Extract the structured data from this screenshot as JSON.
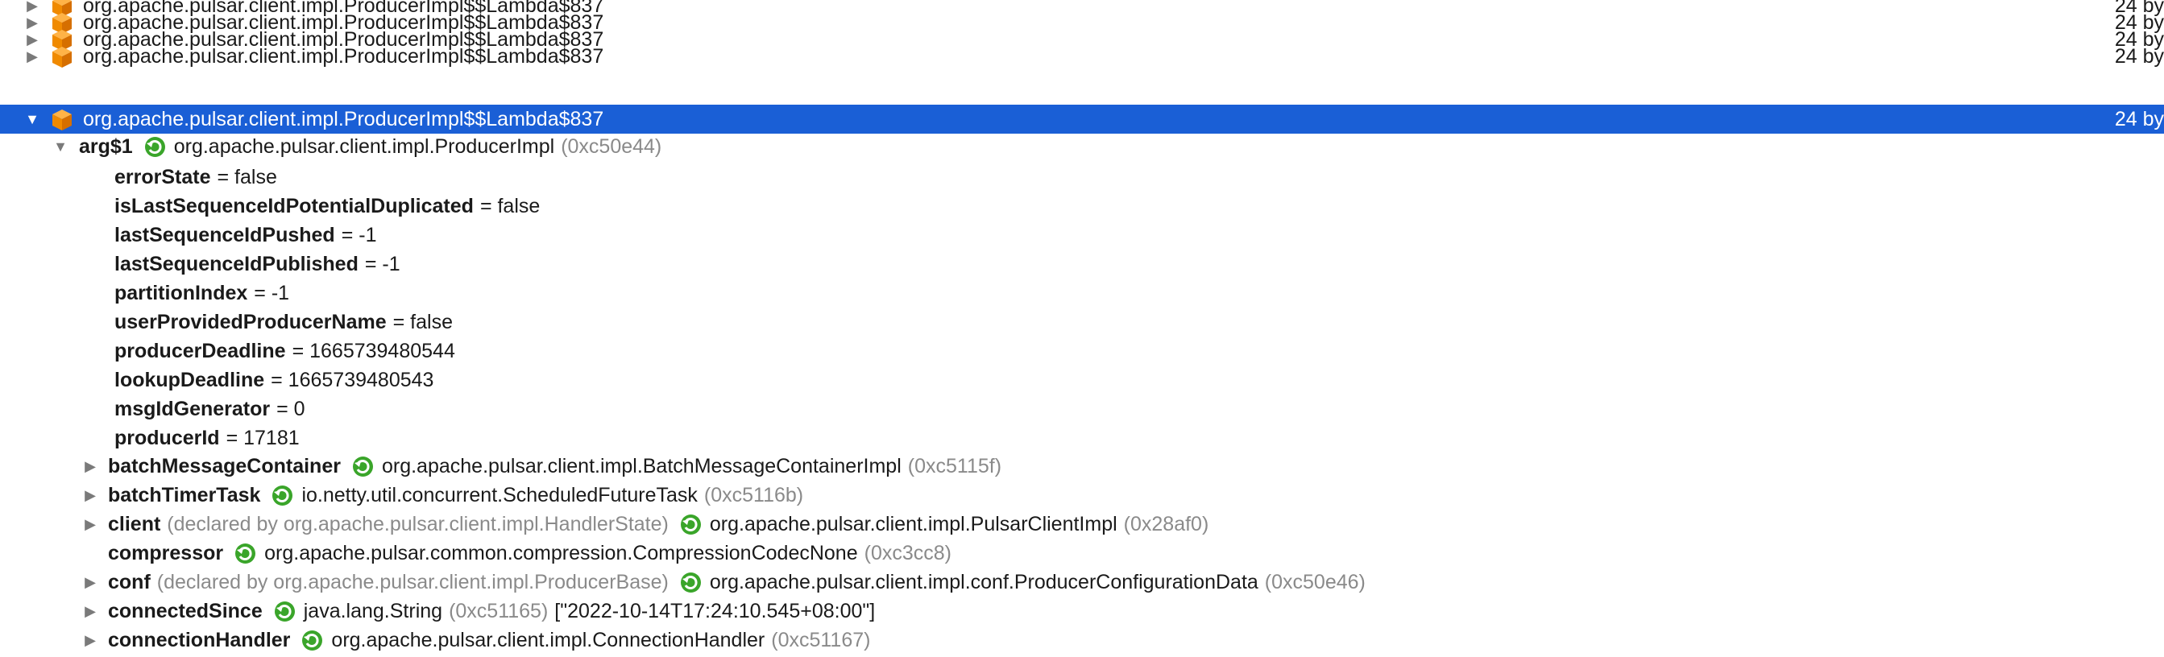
{
  "top_rows": [
    {
      "label": "org.apache.pulsar.client.impl.ProducerImpl$$Lambda$837",
      "size": "24 by"
    },
    {
      "label": "org.apache.pulsar.client.impl.ProducerImpl$$Lambda$837",
      "size": "24 by"
    },
    {
      "label": "org.apache.pulsar.client.impl.ProducerImpl$$Lambda$837",
      "size": "24 by"
    },
    {
      "label": "org.apache.pulsar.client.impl.ProducerImpl$$Lambda$837",
      "size": "24 by"
    }
  ],
  "selected_row": {
    "label": "org.apache.pulsar.client.impl.ProducerImpl$$Lambda$837",
    "size": "24 by"
  },
  "arg": {
    "name": "arg$1",
    "type": "org.apache.pulsar.client.impl.ProducerImpl",
    "id": "(0xc50e44)"
  },
  "primitive_fields": [
    {
      "name": "errorState",
      "value": "= false"
    },
    {
      "name": "isLastSequenceIdPotentialDuplicated",
      "value": "= false"
    },
    {
      "name": "lastSequenceIdPushed",
      "value": "= -1"
    },
    {
      "name": "lastSequenceIdPublished",
      "value": "= -1"
    },
    {
      "name": "partitionIndex",
      "value": "= -1"
    },
    {
      "name": "userProvidedProducerName",
      "value": "= false"
    },
    {
      "name": "producerDeadline",
      "value": "= 1665739480544"
    },
    {
      "name": "lookupDeadline",
      "value": "= 1665739480543"
    },
    {
      "name": "msgIdGenerator",
      "value": "= 0"
    },
    {
      "name": "producerId",
      "value": "= 17181"
    }
  ],
  "object_fields": [
    {
      "name": "batchMessageContainer",
      "declared": "",
      "type": "org.apache.pulsar.client.impl.BatchMessageContainerImpl",
      "id": "(0xc5115f)",
      "extra": ""
    },
    {
      "name": "batchTimerTask",
      "declared": "",
      "type": "io.netty.util.concurrent.ScheduledFutureTask",
      "id": "(0xc5116b)",
      "extra": ""
    },
    {
      "name": "client",
      "declared": "(declared by org.apache.pulsar.client.impl.HandlerState)",
      "type": "org.apache.pulsar.client.impl.PulsarClientImpl",
      "id": "(0x28af0)",
      "extra": ""
    },
    {
      "name": "compressor",
      "declared": "",
      "type": "org.apache.pulsar.common.compression.CompressionCodecNone",
      "id": "(0xc3cc8)",
      "extra": ""
    },
    {
      "name": "conf",
      "declared": "(declared by org.apache.pulsar.client.impl.ProducerBase)",
      "type": "org.apache.pulsar.client.impl.conf.ProducerConfigurationData",
      "id": "(0xc50e46)",
      "extra": ""
    },
    {
      "name": "connectedSince",
      "declared": "",
      "type": "java.lang.String",
      "id": "(0xc51165)",
      "extra": "[\"2022-10-14T17:24:10.545+08:00\"]"
    },
    {
      "name": "connectionHandler",
      "declared": "",
      "type": "org.apache.pulsar.client.impl.ConnectionHandler",
      "id": "(0xc51167)",
      "extra": ""
    }
  ],
  "colors": {
    "selection": "#1a5fd6",
    "cube": "#f08a00",
    "ok_icon": "#3aa52a"
  }
}
